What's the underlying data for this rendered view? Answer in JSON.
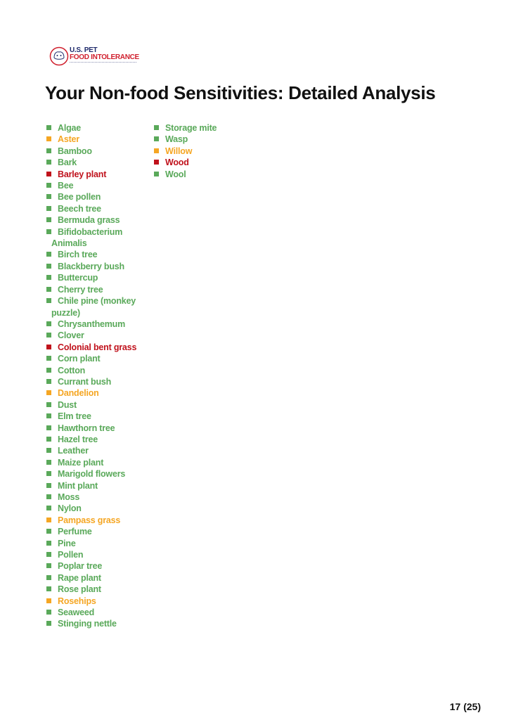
{
  "logo": {
    "line1": "U.S. PET",
    "line2": "FOOD INTOLERANCE"
  },
  "title": "Your Non-food Sensitivities: Detailed Analysis",
  "colors": {
    "green": "#5aa95a",
    "orange": "#f5a623",
    "red": "#c0121c"
  },
  "columns": [
    [
      {
        "label": "Algae",
        "status": "green"
      },
      {
        "label": "Aster",
        "status": "orange"
      },
      {
        "label": "Bamboo",
        "status": "green"
      },
      {
        "label": "Bark",
        "status": "green"
      },
      {
        "label": "Barley plant",
        "status": "red"
      },
      {
        "label": "Bee",
        "status": "green"
      },
      {
        "label": "Bee pollen",
        "status": "green"
      },
      {
        "label": "Beech tree",
        "status": "green"
      },
      {
        "label": "Bermuda grass",
        "status": "green"
      },
      {
        "label": "Bifidobacterium Animalis",
        "status": "green"
      },
      {
        "label": "Birch tree",
        "status": "green"
      },
      {
        "label": "Blackberry bush",
        "status": "green"
      },
      {
        "label": "Buttercup",
        "status": "green"
      },
      {
        "label": "Cherry tree",
        "status": "green"
      },
      {
        "label": "Chile pine (monkey puzzle)",
        "status": "green"
      },
      {
        "label": "Chrysanthemum",
        "status": "green"
      },
      {
        "label": "Clover",
        "status": "green"
      },
      {
        "label": "Colonial bent grass",
        "status": "red"
      },
      {
        "label": "Corn plant",
        "status": "green"
      },
      {
        "label": "Cotton",
        "status": "green"
      },
      {
        "label": "Currant bush",
        "status": "green"
      },
      {
        "label": "Dandelion",
        "status": "orange"
      },
      {
        "label": "Dust",
        "status": "green"
      },
      {
        "label": "Elm tree",
        "status": "green"
      },
      {
        "label": "Hawthorn tree",
        "status": "green"
      },
      {
        "label": "Hazel tree",
        "status": "green"
      },
      {
        "label": "Leather",
        "status": "green"
      },
      {
        "label": "Maize plant",
        "status": "green"
      },
      {
        "label": "Marigold flowers",
        "status": "green"
      },
      {
        "label": "Mint plant",
        "status": "green"
      },
      {
        "label": "Moss",
        "status": "green"
      },
      {
        "label": "Nylon",
        "status": "green"
      },
      {
        "label": "Pampass grass",
        "status": "orange"
      },
      {
        "label": "Perfume",
        "status": "green"
      },
      {
        "label": "Pine",
        "status": "green"
      },
      {
        "label": "Pollen",
        "status": "green"
      },
      {
        "label": "Poplar tree",
        "status": "green"
      },
      {
        "label": "Rape plant",
        "status": "green"
      },
      {
        "label": "Rose plant",
        "status": "green"
      },
      {
        "label": "Rosehips",
        "status": "orange"
      },
      {
        "label": "Seaweed",
        "status": "green"
      },
      {
        "label": "Stinging nettle",
        "status": "green"
      }
    ],
    [
      {
        "label": "Storage mite",
        "status": "green"
      },
      {
        "label": "Wasp",
        "status": "green"
      },
      {
        "label": "Willow",
        "status": "orange"
      },
      {
        "label": "Wood",
        "status": "red"
      },
      {
        "label": "Wool",
        "status": "green"
      }
    ]
  ],
  "page_number": "17 (25)"
}
